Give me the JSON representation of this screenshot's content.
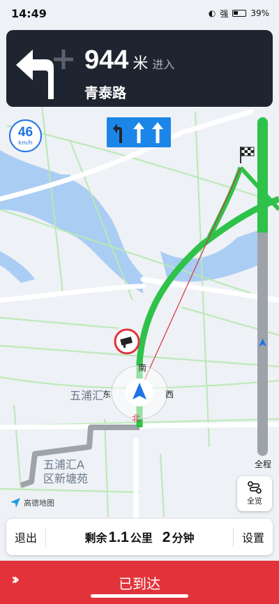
{
  "status": {
    "time": "14:49",
    "signal": "强",
    "battery": "39%"
  },
  "navigation": {
    "distance": "944",
    "unit": "米",
    "action": "进入",
    "road": "青泰路",
    "turn_icon": "turn-left-arrow-icon",
    "lanes": [
      "turn-left-icon",
      "straight-icon",
      "straight-icon"
    ]
  },
  "speed": {
    "value": "46",
    "unit": "km/h"
  },
  "route_progress": {
    "fraction_done": 0.66,
    "label": "全程"
  },
  "map": {
    "labels": {
      "wupu": "五浦汇",
      "wupu_a_line1": "五浦汇A",
      "wupu_a_line2": "区新塘苑"
    },
    "compass": {
      "east": "东",
      "south": "南",
      "west": "西",
      "north": "北"
    },
    "route_color": "#2ec24a",
    "traveled_color": "#9ea3aa"
  },
  "overview_button": {
    "label": "全览"
  },
  "brand": {
    "name": "高德地图"
  },
  "bottom_bar": {
    "exit": "退出",
    "remaining_prefix": "剩余",
    "distance": "1.1",
    "distance_unit": "公里",
    "time": "2",
    "time_unit": "分钟",
    "settings": "设置"
  },
  "arrived_button": {
    "label": "已到达",
    "color": "#e2333b"
  }
}
